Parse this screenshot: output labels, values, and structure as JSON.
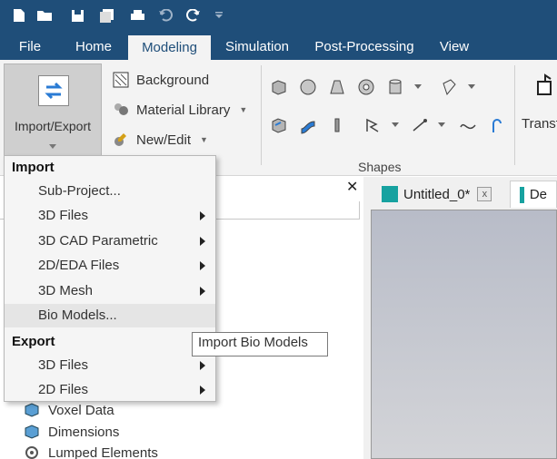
{
  "quick_access": {
    "icons": [
      "new-file-icon",
      "open-folder-icon",
      "save-icon",
      "save-all-icon",
      "print-icon",
      "undo-icon",
      "redo-icon",
      "customize-dropdown-icon"
    ]
  },
  "ribbon_tabs": [
    {
      "label": "File"
    },
    {
      "label": "Home"
    },
    {
      "label": "Modeling"
    },
    {
      "label": "Simulation"
    },
    {
      "label": "Post-Processing"
    },
    {
      "label": "View"
    }
  ],
  "ribbon": {
    "import_export_label": "Import/Export",
    "background_label": "Background",
    "material_library_label": "Material Library",
    "new_edit_label": "New/Edit",
    "shapes_group_label": "Shapes",
    "transform_label_partial": "Transf"
  },
  "dropdown": {
    "import_header": "Import",
    "import_items": [
      {
        "label": "Sub-Project...",
        "submenu": false
      },
      {
        "label": "3D Files",
        "submenu": true
      },
      {
        "label": "3D CAD Parametric",
        "submenu": true
      },
      {
        "label": "2D/EDA Files",
        "submenu": true
      },
      {
        "label": "3D Mesh",
        "submenu": true
      },
      {
        "label": "Bio Models...",
        "submenu": false
      }
    ],
    "export_header": "Export",
    "export_items": [
      {
        "label": "3D Files",
        "submenu": true
      },
      {
        "label": "2D Files",
        "submenu": true
      }
    ]
  },
  "tooltip": {
    "text": "Import Bio Models"
  },
  "tree": {
    "items": [
      {
        "label": "Voxel Data",
        "icon": "voxel-icon"
      },
      {
        "label": "Dimensions",
        "icon": "dimensions-icon"
      },
      {
        "label": "Lumped Elements",
        "icon": "lumped-elements-icon"
      }
    ]
  },
  "doc_tabs": [
    {
      "label": "Untitled_0*",
      "close": "x"
    },
    {
      "label": "De"
    }
  ],
  "colors": {
    "title_bar": "#1f4e79",
    "ribbon_bg": "#f3f3f3",
    "doc_icon": "#17a2a0"
  }
}
